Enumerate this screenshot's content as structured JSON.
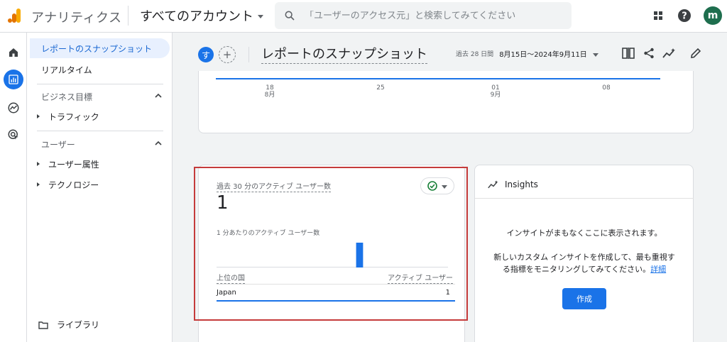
{
  "topbar": {
    "app_title": "アナリティクス",
    "account": "すべてのアカウント",
    "search_placeholder": "「ユーザーのアクセス元」と検索してみてください",
    "avatar_initial": "m"
  },
  "sidebar": {
    "items": [
      {
        "label": "レポートのスナップショット",
        "active": true
      },
      {
        "label": "リアルタイム",
        "active": false
      }
    ],
    "sections": [
      {
        "title": "ビジネス目標",
        "children": [
          "トラフィック"
        ]
      },
      {
        "title": "ユーザー",
        "children": [
          "ユーザー属性",
          "テクノロジー"
        ]
      }
    ],
    "library": "ライブラリ"
  },
  "header": {
    "badge": "す",
    "add": "+",
    "title": "レポートのスナップショット",
    "date_prefix": "過去 28 日間",
    "date_range": "8月15日〜2024年9月11日"
  },
  "timeline": {
    "ticks": [
      {
        "day": "18",
        "month": "8月"
      },
      {
        "day": "25",
        "month": ""
      },
      {
        "day": "01",
        "month": "9月"
      },
      {
        "day": "08",
        "month": ""
      }
    ]
  },
  "realtime_card": {
    "label": "過去 30 分のアクティブ ユーザー数",
    "value": "1",
    "sub_label": "1 分あたりのアクティブ ユーザー数",
    "per_minute": [
      0,
      0,
      0,
      0,
      0,
      0,
      0,
      0,
      0,
      0,
      0,
      0,
      0,
      0,
      0,
      0,
      0,
      0,
      0,
      0,
      0,
      0,
      0,
      0,
      0,
      0,
      0,
      0,
      0,
      0,
      1,
      0,
      0,
      0,
      0,
      0,
      0,
      0,
      0,
      0,
      0,
      0,
      0,
      0,
      0,
      0,
      0,
      0,
      0,
      0
    ],
    "col_country": "上位の国",
    "col_users": "アクティブ ユーザー",
    "rows": [
      {
        "country": "Japan",
        "users": "1"
      }
    ]
  },
  "insights_card": {
    "title": "Insights",
    "line1": "インサイトがまもなくここに表示されます。",
    "line2": "新しいカスタム インサイトを作成して、最も重視す",
    "line3": "る指標をモニタリングしてみてください。",
    "link": "詳細",
    "button": "作成"
  },
  "colors": {
    "accent": "#1a73e8",
    "highlight": "#c53b3b",
    "status_ok": "#188038"
  }
}
